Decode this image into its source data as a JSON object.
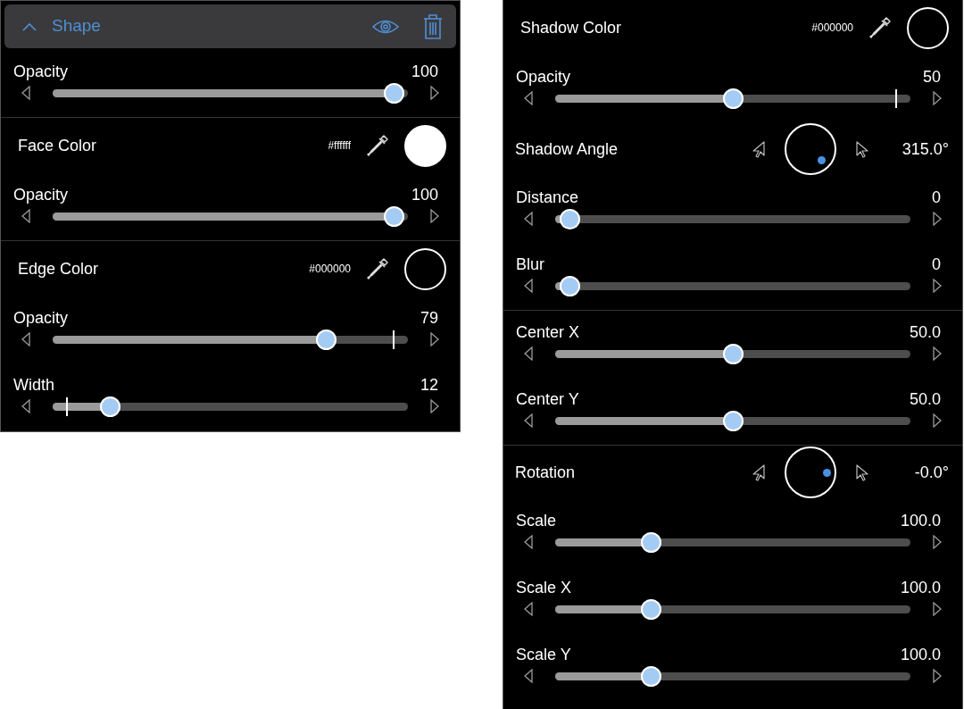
{
  "left_panel": {
    "header": {
      "title": "Shape",
      "expanded": true
    },
    "sections": [
      {
        "rows": [
          {
            "kind": "slider",
            "label": "Opacity",
            "value": "100",
            "level": 0.96
          }
        ]
      },
      {
        "rows": [
          {
            "kind": "color",
            "label": "Face Color",
            "hex": "#ffffff",
            "color": "#ffffff"
          },
          {
            "kind": "slider",
            "label": "Opacity",
            "value": "100",
            "level": 0.96
          }
        ]
      },
      {
        "rows": [
          {
            "kind": "color",
            "label": "Edge Color",
            "hex": "#000000",
            "color": "#000000"
          },
          {
            "kind": "slider",
            "label": "Opacity",
            "value": "79",
            "level": 0.77,
            "default_mark": {
              "level": 0.96
            }
          },
          {
            "kind": "slider",
            "label": "Width",
            "value": "12",
            "level": 0.16,
            "default_mark": {
              "level": 0.04
            }
          }
        ]
      }
    ]
  },
  "right_panel": {
    "sections": [
      {
        "rows": [
          {
            "kind": "color",
            "label": "Shadow Color",
            "hex": "#000000",
            "color": "#000000"
          },
          {
            "kind": "slider",
            "label": "Opacity",
            "value": "50",
            "level": 0.5,
            "default_mark": {
              "level": 0.96
            }
          },
          {
            "kind": "dial",
            "label": "Shadow Angle",
            "value": "315.0°",
            "dot_below_center": true
          },
          {
            "kind": "slider",
            "label": "Distance",
            "value": "0",
            "level": 0.04
          },
          {
            "kind": "slider",
            "label": "Blur",
            "value": "0",
            "level": 0.04
          }
        ]
      },
      {
        "rows": [
          {
            "kind": "slider",
            "label": "Center X",
            "value": "50.0",
            "level": 0.5
          },
          {
            "kind": "slider",
            "label": "Center Y",
            "value": "50.0",
            "level": 0.5
          }
        ]
      },
      {
        "rows": [
          {
            "kind": "dial",
            "label": "Rotation",
            "value": "-0.0°",
            "dot_below_center": false
          },
          {
            "kind": "slider",
            "label": "Scale",
            "value": "100.0",
            "level": 0.27
          },
          {
            "kind": "slider",
            "label": "Scale X",
            "value": "100.0",
            "level": 0.27
          },
          {
            "kind": "slider",
            "label": "Scale Y",
            "value": "100.0",
            "level": 0.27
          }
        ]
      }
    ]
  }
}
